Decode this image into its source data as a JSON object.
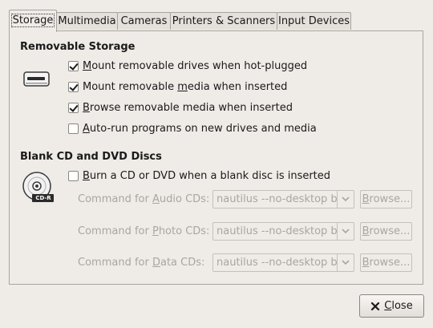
{
  "tabs": [
    {
      "label": "Storage",
      "active": true
    },
    {
      "label": "Multimedia",
      "active": false
    },
    {
      "label": "Cameras",
      "active": false
    },
    {
      "label": "Printers & Scanners",
      "active": false
    },
    {
      "label": "Input Devices",
      "active": false
    }
  ],
  "removable": {
    "title": "Removable Storage",
    "icon": "drive-icon",
    "options": [
      {
        "pre": "",
        "key": "M",
        "post": "ount removable drives when hot-plugged",
        "checked": true
      },
      {
        "pre": "Mount removable ",
        "key": "m",
        "post": "edia when inserted",
        "checked": true
      },
      {
        "pre": "",
        "key": "B",
        "post": "rowse removable media when inserted",
        "checked": true
      },
      {
        "pre": "",
        "key": "A",
        "post": "uto-run programs on new drives and media",
        "checked": false
      }
    ]
  },
  "blank": {
    "title": "Blank CD and DVD Discs",
    "icon": "cdr-icon",
    "icon_label": "CD-R",
    "burn": {
      "pre": "",
      "key": "B",
      "post": "urn a CD or DVD when a blank disc is inserted",
      "checked": false
    },
    "commands": [
      {
        "pre": "Command for ",
        "key": "A",
        "post": "udio CDs:",
        "value": "nautilus --no-desktop bu",
        "browse_pre": "",
        "browse_key": "B",
        "browse_post": "rowse..."
      },
      {
        "pre": "Command for ",
        "key": "P",
        "post": "hoto CDs:",
        "value": "nautilus --no-desktop bu",
        "browse_pre": "",
        "browse_key": "B",
        "browse_post": "rowse..."
      },
      {
        "pre": "Command for ",
        "key": "D",
        "post": "ata CDs:",
        "value": "nautilus --no-desktop bu",
        "browse_pre": "",
        "browse_key": "B",
        "browse_post": "rowse..."
      }
    ]
  },
  "footer": {
    "close_key": "C",
    "close_post": "lose",
    "close_icon": "close-icon"
  }
}
